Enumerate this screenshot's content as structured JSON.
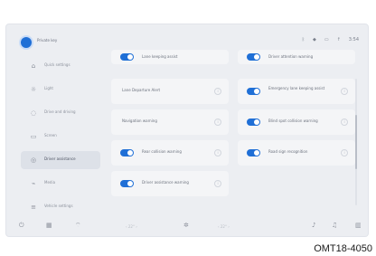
{
  "statusbar": {
    "profile_name": "Private key",
    "icons": [
      "bluetooth-icon",
      "wifi-icon",
      "signal-icon",
      "battery-icon"
    ],
    "time": "3:54",
    "icon_glyphs": [
      "ᛒ",
      "◆",
      "▭",
      "↑"
    ]
  },
  "sidebar": {
    "items": [
      {
        "icon": "⌂",
        "label": "Quick settings"
      },
      {
        "icon": "☼",
        "label": "Light"
      },
      {
        "icon": "◌",
        "label": "Drive and driving"
      },
      {
        "icon": "▭",
        "label": "Screen"
      },
      {
        "icon": "◎",
        "label": "Driver assistance",
        "active": true
      },
      {
        "icon": "⌁",
        "label": "Media"
      },
      {
        "icon": "≡",
        "label": "Vehicle settings"
      }
    ]
  },
  "main": {
    "cards": [
      {
        "label": "Lane keeping assist",
        "toggle": true
      },
      {
        "label": "Driver attention warning",
        "toggle": true
      },
      {
        "label": "Lane Departure Alert",
        "toggle": false
      },
      {
        "label": "Emergency lane keeping assist",
        "toggle": true
      },
      {
        "label": "Navigation warning",
        "toggle": false
      },
      {
        "label": "Blind spot collision warning",
        "toggle": true
      },
      {
        "label": "Rear collision warning",
        "toggle": true
      },
      {
        "label": "Road sign recognition",
        "toggle": true
      },
      {
        "label": "Driver assistance warning",
        "toggle": true
      }
    ],
    "info_glyph": "i"
  },
  "navbar": {
    "glyphs": [
      "⏻",
      "▦",
      "⌔",
      "‹ 22° ›",
      "✲",
      "‹ 22° ›",
      "♪",
      "♫",
      "▥"
    ]
  },
  "caption": "OMT18-4050",
  "colors": {
    "accent": "#1f6fd6",
    "background": "#eceef2",
    "card": "#f4f5f7"
  }
}
